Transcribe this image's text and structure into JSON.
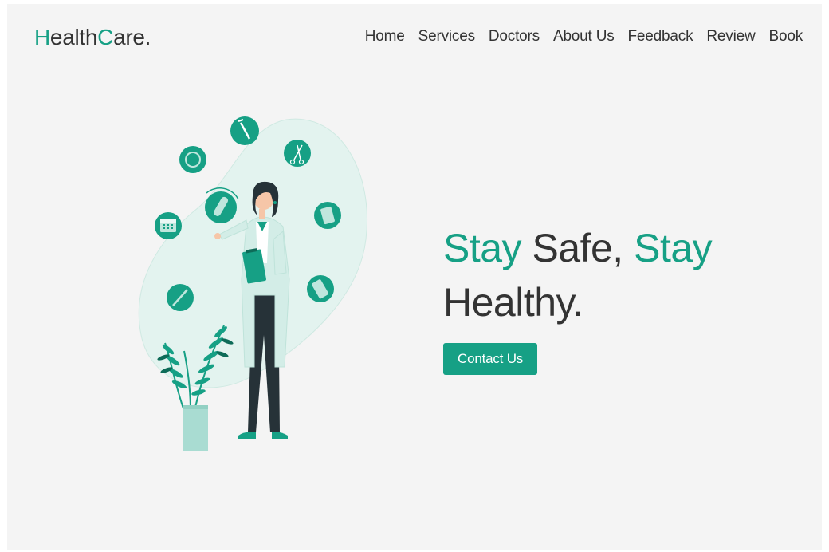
{
  "brand": {
    "logo_first_initial": "H",
    "logo_first_rest": "ealth",
    "logo_second_initial": "C",
    "logo_second_rest": "are."
  },
  "nav": {
    "items": [
      "Home",
      "Services",
      "Doctors",
      "About Us",
      "Feedback",
      "Review",
      "Book"
    ]
  },
  "hero": {
    "word_stay_1": "Stay",
    "word_safe": " Safe, ",
    "word_stay_2": "Stay",
    "word_healthy": "Healthy.",
    "cta_label": "Contact Us"
  },
  "illustration": {
    "subject": "doctor-with-clipboard",
    "icons": [
      "syringe-icon",
      "scissors-icon",
      "pill-bottle-icon",
      "pill-blister-icon",
      "bandage-icon",
      "calendar-icon",
      "ring-icon",
      "capsule-icon"
    ]
  },
  "colors": {
    "accent": "#16a085",
    "text": "#333333",
    "background": "#f4f4f4",
    "blob": "#e3f3ef"
  }
}
